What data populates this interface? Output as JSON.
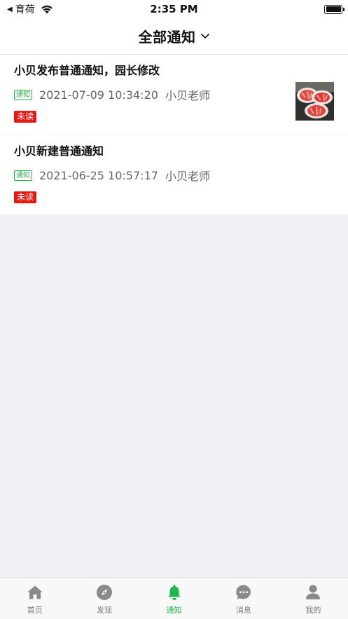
{
  "status_bar": {
    "back_app": "育荷",
    "time": "2:35 PM"
  },
  "header": {
    "title": "全部通知"
  },
  "notices": [
    {
      "title": "小贝发布普通通知，园长修改",
      "type_tag": "通知",
      "time": "2021-07-09 10:34:20",
      "author": "小贝老师",
      "status": "未读",
      "has_thumbnail": true
    },
    {
      "title": "小贝新建普通通知",
      "type_tag": "通知",
      "time": "2021-06-25 10:57:17",
      "author": "小贝老师",
      "status": "未读",
      "has_thumbnail": false
    }
  ],
  "tab_bar": {
    "items": [
      {
        "label": "首页",
        "icon": "home-icon"
      },
      {
        "label": "发现",
        "icon": "compass-icon"
      },
      {
        "label": "通知",
        "icon": "bell-icon",
        "active": true
      },
      {
        "label": "消息",
        "icon": "chat-bubble-icon"
      },
      {
        "label": "我的",
        "icon": "user-icon"
      }
    ]
  },
  "colors": {
    "accent_green": "#1cb84a",
    "unread_red": "#e9170f",
    "tag_green": "#27b04a"
  }
}
